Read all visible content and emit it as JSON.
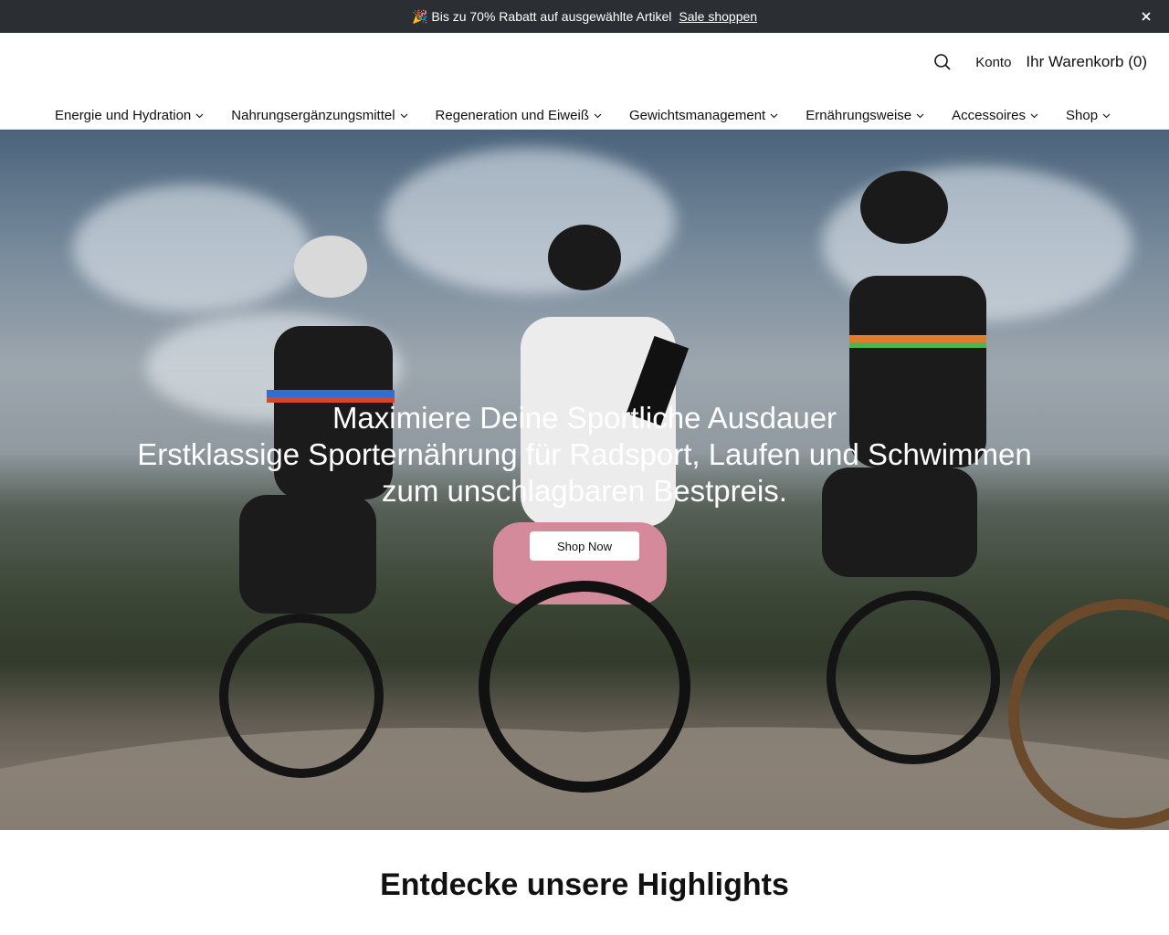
{
  "announcement": {
    "emoji": "🎉",
    "text": "Bis zu 70% Rabatt auf ausgewählte Artikel",
    "link": "Sale shoppen",
    "close": "✕"
  },
  "header": {
    "account": "Konto",
    "cart": "Ihr Warenkorb (0)"
  },
  "nav": {
    "items": [
      {
        "label": "Energie und Hydration"
      },
      {
        "label": "Nahrungsergänzungsmittel"
      },
      {
        "label": "Regeneration und Eiweiß"
      },
      {
        "label": "Gewichtsmanagement"
      },
      {
        "label": "Ernährungsweise"
      },
      {
        "label": "Accessoires"
      },
      {
        "label": "Shop"
      }
    ]
  },
  "hero": {
    "title": "Maximiere Deine Sportliche Ausdauer",
    "subtitle_line1": "Erstklassige Sporternährung für Radsport, Laufen und Schwimmen",
    "subtitle_line2": "zum unschlagbaren Bestpreis.",
    "cta": "Shop Now"
  },
  "highlights": {
    "title": "Entdecke unsere Highlights"
  },
  "colors": {
    "announcement_bg": "#2b2f33",
    "button_bg": "#ffffff"
  }
}
